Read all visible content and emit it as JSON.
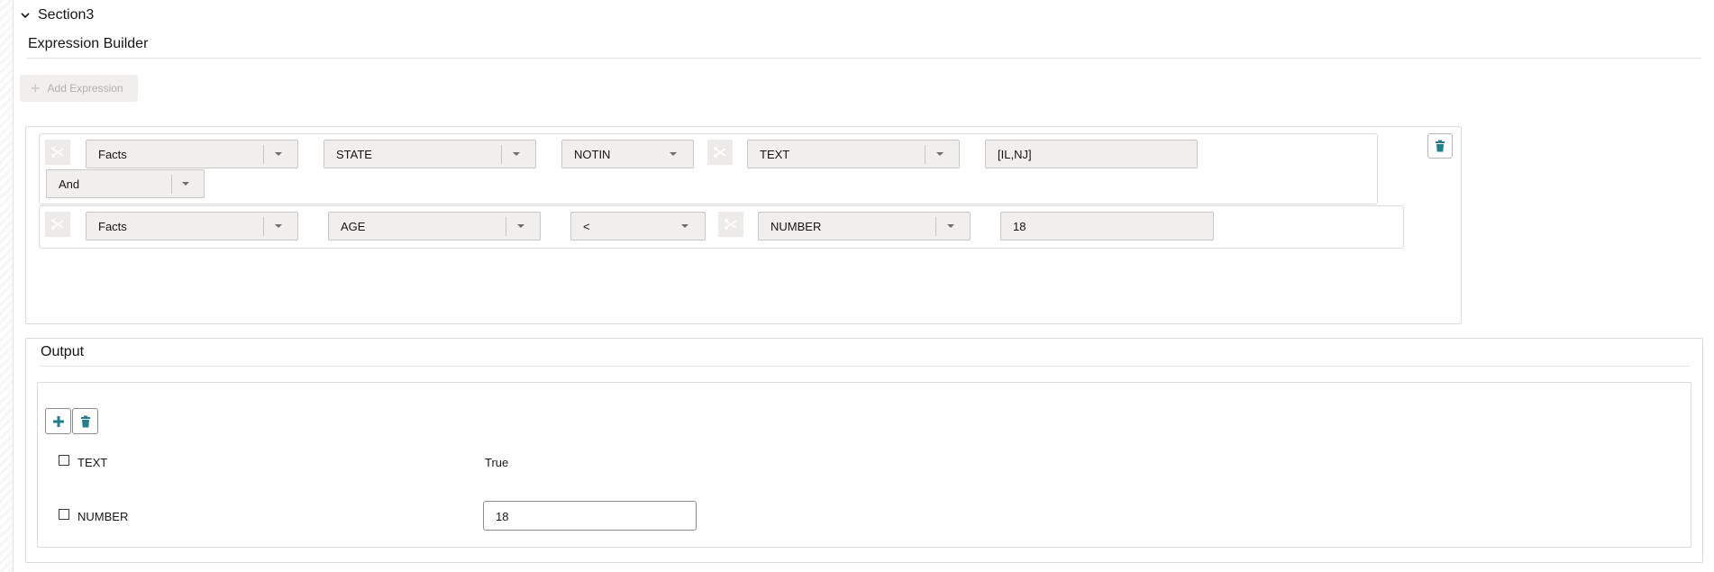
{
  "section": {
    "title": "Section3"
  },
  "expression_builder": {
    "title": "Expression Builder",
    "add_expression_label": "Add Expression",
    "row1": {
      "source": "Facts",
      "field": "STATE",
      "operator": "NOTIN",
      "type": "TEXT",
      "value": "[IL,NJ]",
      "conjunction": "And"
    },
    "row2": {
      "source": "Facts",
      "field": "AGE",
      "operator": "<",
      "type": "NUMBER",
      "value": "18"
    }
  },
  "output": {
    "title": "Output",
    "rows": [
      {
        "label": "TEXT",
        "value": "True"
      },
      {
        "label": "NUMBER",
        "value": "18"
      }
    ]
  },
  "icons": {
    "collapse": "chevron-down-icon",
    "delete": "trash-icon",
    "add": "plus-icon",
    "cut": "scissors-icon"
  },
  "colors": {
    "accent": "#227e8b",
    "disabled": "#c9c7c4",
    "field_bg": "#f1efed"
  }
}
